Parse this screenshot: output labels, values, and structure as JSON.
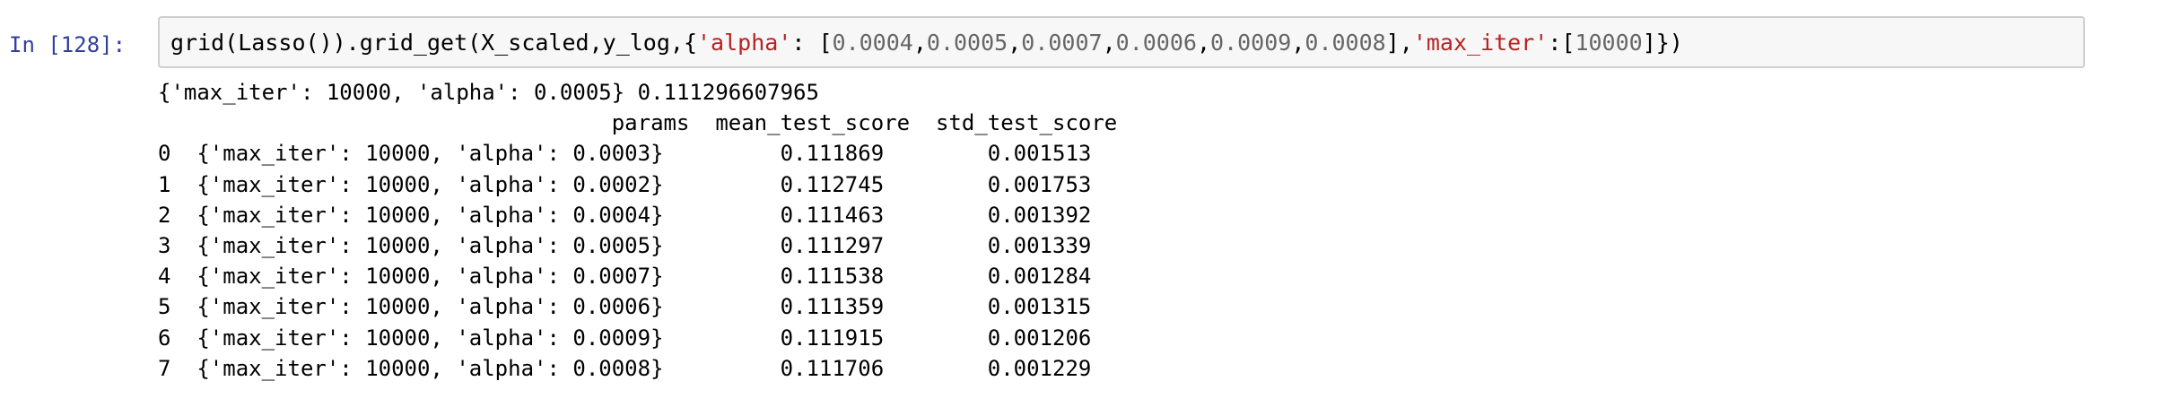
{
  "cell": {
    "prompt": "In [128]:",
    "code_tokens": [
      {
        "text": "grid(Lasso()).grid_get(X_scaled,y_log,{",
        "type": "plain"
      },
      {
        "text": "'alpha'",
        "type": "str"
      },
      {
        "text": ": [",
        "type": "plain"
      },
      {
        "text": "0.0004",
        "type": "num"
      },
      {
        "text": ",",
        "type": "plain"
      },
      {
        "text": "0.0005",
        "type": "num"
      },
      {
        "text": ",",
        "type": "plain"
      },
      {
        "text": "0.0007",
        "type": "num"
      },
      {
        "text": ",",
        "type": "plain"
      },
      {
        "text": "0.0006",
        "type": "num"
      },
      {
        "text": ",",
        "type": "plain"
      },
      {
        "text": "0.0009",
        "type": "num"
      },
      {
        "text": ",",
        "type": "plain"
      },
      {
        "text": "0.0008",
        "type": "num"
      },
      {
        "text": "],",
        "type": "plain"
      },
      {
        "text": "'max_iter'",
        "type": "str"
      },
      {
        "text": ":[",
        "type": "plain"
      },
      {
        "text": "10000",
        "type": "num"
      },
      {
        "text": "]})",
        "type": "plain"
      }
    ],
    "output_lines": [
      "{'max_iter': 10000, 'alpha': 0.0005} 0.111296607965",
      "                                   params  mean_test_score  std_test_score",
      "0  {'max_iter': 10000, 'alpha': 0.0003}         0.111869        0.001513",
      "1  {'max_iter': 10000, 'alpha': 0.0002}         0.112745        0.001753",
      "2  {'max_iter': 10000, 'alpha': 0.0004}         0.111463        0.001392",
      "3  {'max_iter': 10000, 'alpha': 0.0005}         0.111297        0.001339",
      "4  {'max_iter': 10000, 'alpha': 0.0007}         0.111538        0.001284",
      "5  {'max_iter': 10000, 'alpha': 0.0006}         0.111359        0.001315",
      "6  {'max_iter': 10000, 'alpha': 0.0009}         0.111915        0.001206",
      "7  {'max_iter': 10000, 'alpha': 0.0008}         0.111706        0.001229"
    ]
  }
}
